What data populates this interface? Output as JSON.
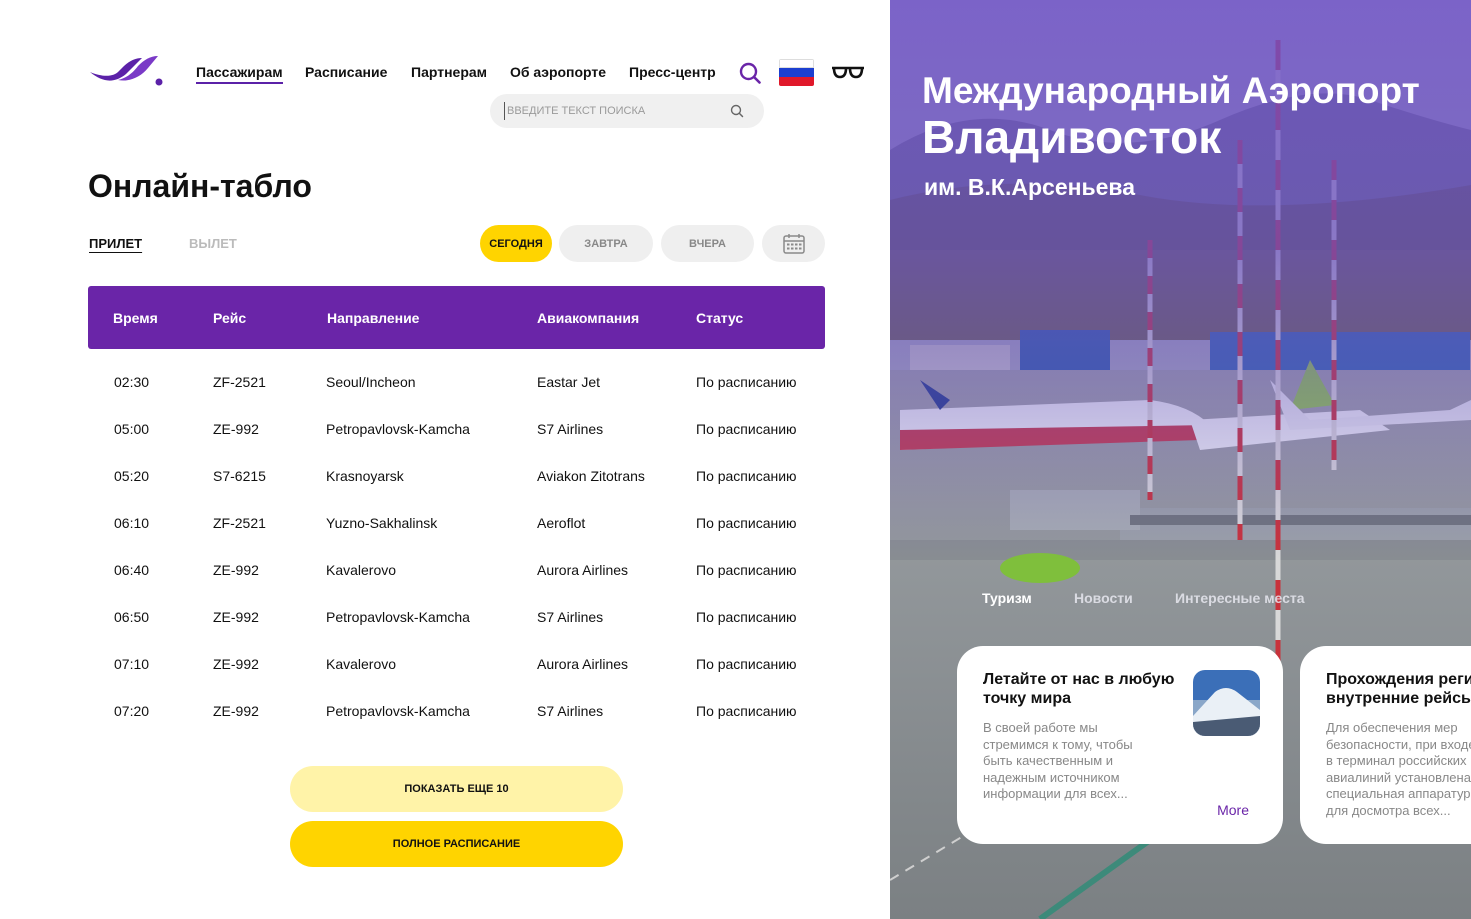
{
  "header": {
    "nav": [
      {
        "label": "Пассажирам",
        "active": true
      },
      {
        "label": "Расписание"
      },
      {
        "label": "Партнерам"
      },
      {
        "label": "Об аэропорте"
      },
      {
        "label": "Пресс-центр"
      }
    ],
    "search_placeholder": "введите текст поиска",
    "icons": {
      "search": "search-icon",
      "flag": "russia-flag-icon",
      "accessibility": "glasses-icon"
    },
    "accent_color": "#6a25a8"
  },
  "board": {
    "title": "Онлайн-табло",
    "direction_tabs": [
      {
        "label": "Прилет",
        "active": true
      },
      {
        "label": "Вылет",
        "active": false
      }
    ],
    "day_filters": [
      {
        "label": "Сегодня",
        "active": true
      },
      {
        "label": "Завтра",
        "active": false
      },
      {
        "label": "Вчера",
        "active": false
      }
    ],
    "columns": [
      "Время",
      "Рейс",
      "Направление",
      "Авиакомпания",
      "Статус"
    ],
    "rows": [
      [
        "02:30",
        "ZF-2521",
        "Seoul/Incheon",
        "Eastar Jet",
        "По расписанию"
      ],
      [
        "05:00",
        "ZE-992",
        "Petropavlovsk-Kamcha",
        "S7 Airlines",
        "По расписанию"
      ],
      [
        "05:20",
        "S7-6215",
        "Krasnoyarsk",
        "Aviakon Zitotrans",
        "По расписанию"
      ],
      [
        "06:10",
        "ZF-2521",
        "Yuzno-Sakhalinsk",
        "Aeroflot",
        "По расписанию"
      ],
      [
        "06:40",
        "ZE-992",
        "Kavalerovo",
        "Aurora Airlines",
        "По расписанию"
      ],
      [
        "06:50",
        "ZE-992",
        "Petropavlovsk-Kamcha",
        "S7 Airlines",
        "По расписанию"
      ],
      [
        "07:10",
        "ZE-992",
        "Kavalerovo",
        "Aurora Airlines",
        "По расписанию"
      ],
      [
        "07:20",
        "ZE-992",
        "Petropavlovsk-Kamcha",
        "S7 Airlines",
        "По расписанию"
      ]
    ],
    "show_more_label": "ПОКАЗАТЬ ЕЩЕ 10",
    "full_schedule_label": "ПОЛНОЕ РАСПИСАНИЕ",
    "highlight_color": "#ffd400"
  },
  "hero": {
    "title_line1": "Международный Аэропорт",
    "title_line2": "Владивосток",
    "subtitle": "им. В.К.Арсеньева",
    "tabs": [
      {
        "label": "Туризм",
        "active": true
      },
      {
        "label": "Новости",
        "active": false
      },
      {
        "label": "Интересные места",
        "active": false
      }
    ],
    "cards": [
      {
        "title": "Летайте от нас в любую точку мира",
        "text": "В своей работе мы стремимся к тому, чтобы быть качественным и надежным источником информации для всех...",
        "link": "More"
      },
      {
        "title": "Прохождения регистрации на внутренние рейсы",
        "text": "Для обеспечения мер безопасности, при входе в терминал российских авиалиний установлена специальная аппаратура для досмотра всех..."
      }
    ]
  }
}
